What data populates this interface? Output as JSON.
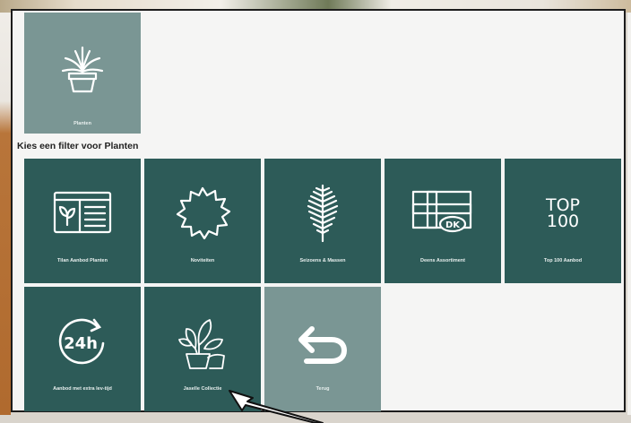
{
  "selected_category": {
    "label": "Planten",
    "icon": "potted-plant-icon"
  },
  "filter_title": "Kies een filter voor Planten",
  "tiles": [
    {
      "label": "Tilan Aanbod Planten",
      "icon": "plant-catalog-icon"
    },
    {
      "label": "Noviteiten",
      "icon": "starburst-icon"
    },
    {
      "label": "Seizoens & Massen",
      "icon": "fern-icon"
    },
    {
      "label": "Deens Assortiment",
      "icon": "denmark-flag-icon"
    },
    {
      "label": "Top 100 Aanbod",
      "icon": "top100-icon"
    },
    {
      "label": "Aanbod met extra lev-tijd",
      "icon": "24h-icon"
    },
    {
      "label": "Jaselle Collectie",
      "icon": "houseplant-collection-icon"
    },
    {
      "label": "Terug",
      "icon": "back-arrow-icon"
    }
  ],
  "top100_text": {
    "line1": "TOP",
    "line2": "100"
  },
  "badge_24h": "24h",
  "dk_badge": "DK",
  "colors": {
    "tile": "#2d5b58",
    "tile_light": "#7a9694",
    "panel": "#f5f5f4"
  }
}
